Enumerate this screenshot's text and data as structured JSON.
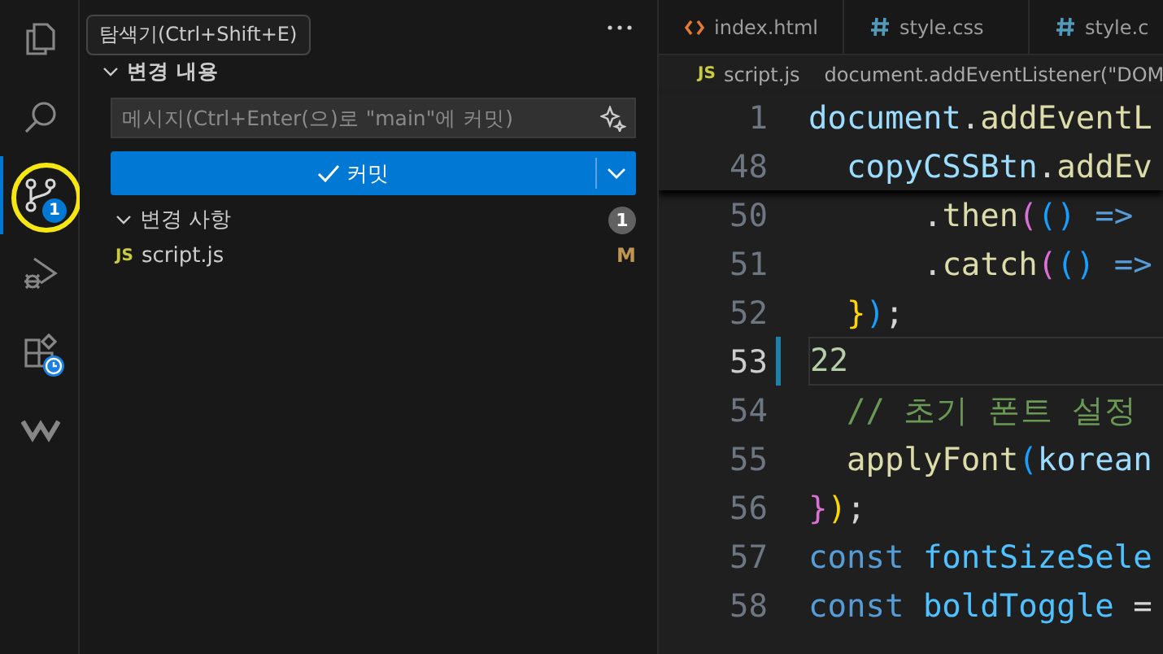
{
  "activity_bar": {
    "items": [
      {
        "kind": "explorer",
        "selected": false,
        "highlighted": false
      },
      {
        "kind": "search",
        "selected": false,
        "highlighted": false
      },
      {
        "kind": "source-control",
        "selected": true,
        "highlighted": true,
        "badge": "1"
      },
      {
        "kind": "run-debug",
        "selected": false,
        "highlighted": false
      },
      {
        "kind": "extensions",
        "selected": false,
        "highlighted": false
      },
      {
        "kind": "logo",
        "selected": false,
        "highlighted": false
      }
    ]
  },
  "tooltip": "탐색기(Ctrl+Shift+E)",
  "sidebar": {
    "sections": [
      {
        "kind": "commit",
        "title": "변경 내용",
        "expanded": true,
        "placeholder": "메시지(Ctrl+Enter(으)로 \"main\"에 커밋)",
        "button": "커밋"
      },
      {
        "kind": "changes",
        "title": "변경 사항",
        "expanded": true,
        "count": "1",
        "files": [
          {
            "icon_text": "JS",
            "name": "script.js",
            "status": "M"
          }
        ]
      }
    ]
  },
  "editor": {
    "tabs": [
      {
        "kind": "html",
        "label": "index.html",
        "selected": false
      },
      {
        "kind": "css",
        "label": "style.css",
        "selected": false
      },
      {
        "kind": "css",
        "label": "style.c",
        "selected": false
      }
    ],
    "breadcrumb": {
      "file_icon_text": "JS",
      "file": "script.js",
      "symbol": "document.addEventListener(\"DOM"
    },
    "lines": [
      {
        "number": "1",
        "sticky": true,
        "current": false,
        "changed": false,
        "tokens": [
          {
            "text": "document",
            "kind": "var"
          },
          {
            "text": ".",
            "kind": "plain"
          },
          {
            "text": "addEventL",
            "kind": "fn"
          }
        ]
      },
      {
        "number": "48",
        "sticky": true,
        "current": false,
        "changed": false,
        "tokens": [
          {
            "text": "  copyCSSBtn",
            "kind": "var"
          },
          {
            "text": ".",
            "kind": "plain"
          },
          {
            "text": "addEv",
            "kind": "fn"
          }
        ]
      },
      {
        "number": "50",
        "sticky": false,
        "current": false,
        "changed": false,
        "tokens": [
          {
            "text": "      .",
            "kind": "plain"
          },
          {
            "text": "then",
            "kind": "fn"
          },
          {
            "text": "(",
            "kind": "br2"
          },
          {
            "text": "()",
            "kind": "br3"
          },
          {
            "text": " =>",
            "kind": "kw"
          }
        ]
      },
      {
        "number": "51",
        "sticky": false,
        "current": false,
        "changed": false,
        "tokens": [
          {
            "text": "      .",
            "kind": "plain"
          },
          {
            "text": "catch",
            "kind": "fn"
          },
          {
            "text": "(",
            "kind": "br2"
          },
          {
            "text": "()",
            "kind": "br3"
          },
          {
            "text": " =>",
            "kind": "kw"
          }
        ]
      },
      {
        "number": "52",
        "sticky": false,
        "current": false,
        "changed": false,
        "tokens": [
          {
            "text": "  }",
            "kind": "br1"
          },
          {
            "text": ")",
            "kind": "br3"
          },
          {
            "text": ";",
            "kind": "plain"
          }
        ]
      },
      {
        "number": "53",
        "sticky": false,
        "current": true,
        "changed": true,
        "tokens": [
          {
            "text": "22",
            "kind": "num"
          }
        ]
      },
      {
        "number": "54",
        "sticky": false,
        "current": false,
        "changed": false,
        "tokens": [
          {
            "text": "  // 초기 폰트 설정",
            "kind": "comment"
          }
        ]
      },
      {
        "number": "55",
        "sticky": false,
        "current": false,
        "changed": false,
        "tokens": [
          {
            "text": "  applyFont",
            "kind": "fn"
          },
          {
            "text": "(",
            "kind": "br3"
          },
          {
            "text": "korean",
            "kind": "var"
          }
        ]
      },
      {
        "number": "56",
        "sticky": false,
        "current": false,
        "changed": false,
        "tokens": [
          {
            "text": "}",
            "kind": "br2"
          },
          {
            "text": ")",
            "kind": "br1"
          },
          {
            "text": ";",
            "kind": "plain"
          }
        ]
      },
      {
        "number": "57",
        "sticky": false,
        "current": false,
        "changed": false,
        "tokens": [
          {
            "text": "const",
            "kind": "kw"
          },
          {
            "text": " fontSizeSele",
            "kind": "const"
          }
        ]
      },
      {
        "number": "58",
        "sticky": false,
        "current": false,
        "changed": false,
        "tokens": [
          {
            "text": "const",
            "kind": "kw"
          },
          {
            "text": " boldToggle",
            "kind": "const"
          },
          {
            "text": " =",
            "kind": "plain"
          }
        ]
      }
    ]
  }
}
